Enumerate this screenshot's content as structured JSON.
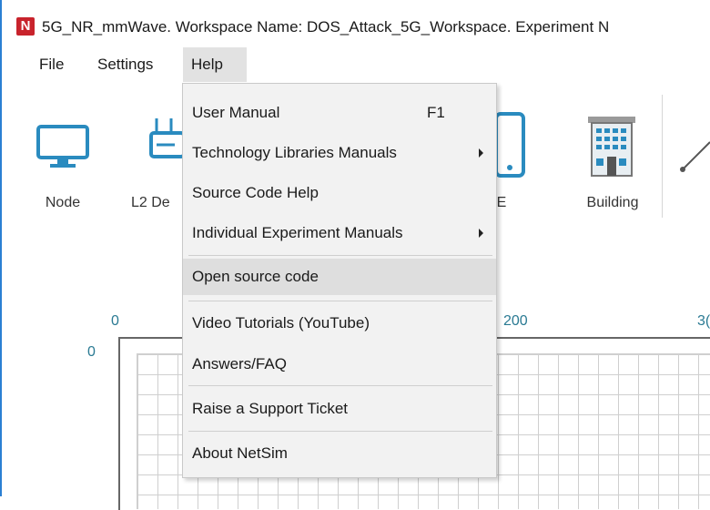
{
  "window": {
    "title": "5G_NR_mmWave. Workspace Name: DOS_Attack_5G_Workspace. Experiment N",
    "logo_letter": "N",
    "logo_color": "#c8232c",
    "accent_color": "#2b7fd3"
  },
  "menubar": {
    "items": [
      {
        "label": "File"
      },
      {
        "label": "Settings"
      },
      {
        "label": "Help",
        "active": true
      }
    ]
  },
  "toolbar": {
    "tools": [
      {
        "label": "Node",
        "icon": "monitor-icon"
      },
      {
        "label": "L2 De",
        "icon": "l2-device-icon"
      },
      {
        "label": "JE",
        "icon": "ue-phone-icon"
      },
      {
        "label": "Building",
        "icon": "building-icon"
      },
      {
        "label": "",
        "icon": "link-icon"
      }
    ]
  },
  "canvas": {
    "x_ticks": [
      "0",
      "200",
      "3("
    ],
    "y_ticks": [
      "0"
    ]
  },
  "help_menu": {
    "items": [
      {
        "label": "User Manual",
        "shortcut": "F1"
      },
      {
        "label": "Technology Libraries Manuals",
        "submenu": true
      },
      {
        "label": "Source Code Help"
      },
      {
        "label": "Individual Experiment Manuals",
        "submenu": true
      },
      {
        "label": "Open source code",
        "highlighted": true
      },
      {
        "label": "Video Tutorials (YouTube)"
      },
      {
        "label": "Answers/FAQ"
      },
      {
        "label": "Raise a Support Ticket"
      },
      {
        "label": "About NetSim"
      }
    ]
  }
}
